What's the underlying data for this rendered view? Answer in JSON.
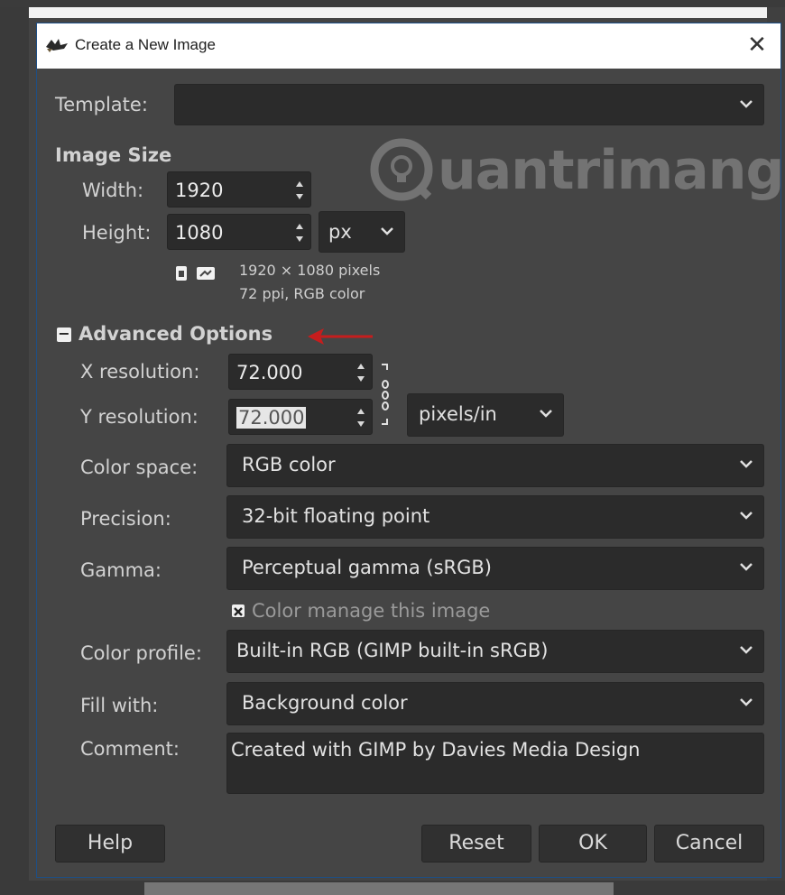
{
  "window": {
    "title": "Create a New Image",
    "close_glyph": "✕",
    "app_icon": "gimp-wilber-icon"
  },
  "template": {
    "label": "Template:",
    "value": ""
  },
  "image_size": {
    "heading": "Image Size",
    "width_label": "Width:",
    "width_value": "1920",
    "height_label": "Height:",
    "height_value": "1080",
    "unit": "px",
    "info_line1": "1920 × 1080 pixels",
    "info_line2": "72 ppi, RGB color"
  },
  "advanced": {
    "heading": "Advanced Options",
    "toggle_glyph": "−",
    "x_res_label": "X resolution:",
    "x_res_value": "72.000",
    "y_res_label": "Y resolution:",
    "y_res_value": "72.000",
    "res_unit": "pixels/in",
    "color_space_label": "Color space:",
    "color_space_value": "RGB color",
    "precision_label": "Precision:",
    "precision_value": "32-bit floating point",
    "gamma_label": "Gamma:",
    "gamma_value": "Perceptual gamma (sRGB)",
    "color_manage_label": "Color manage this image",
    "color_manage_checked": true,
    "color_profile_label": "Color profile:",
    "color_profile_value": "Built-in RGB (GIMP built-in sRGB)",
    "fill_label": "Fill with:",
    "fill_value": "Background color",
    "comment_label": "Comment:",
    "comment_value": "Created with GIMP by Davies Media Design"
  },
  "buttons": {
    "help": "Help",
    "reset": "Reset",
    "ok": "OK",
    "cancel": "Cancel"
  },
  "watermark": {
    "text": "uantrimang"
  },
  "colors": {
    "dialog_bg": "#454545",
    "field_bg": "#2b2b2b",
    "arrow": "#c61d1d",
    "title_bar": "#ffffff"
  }
}
